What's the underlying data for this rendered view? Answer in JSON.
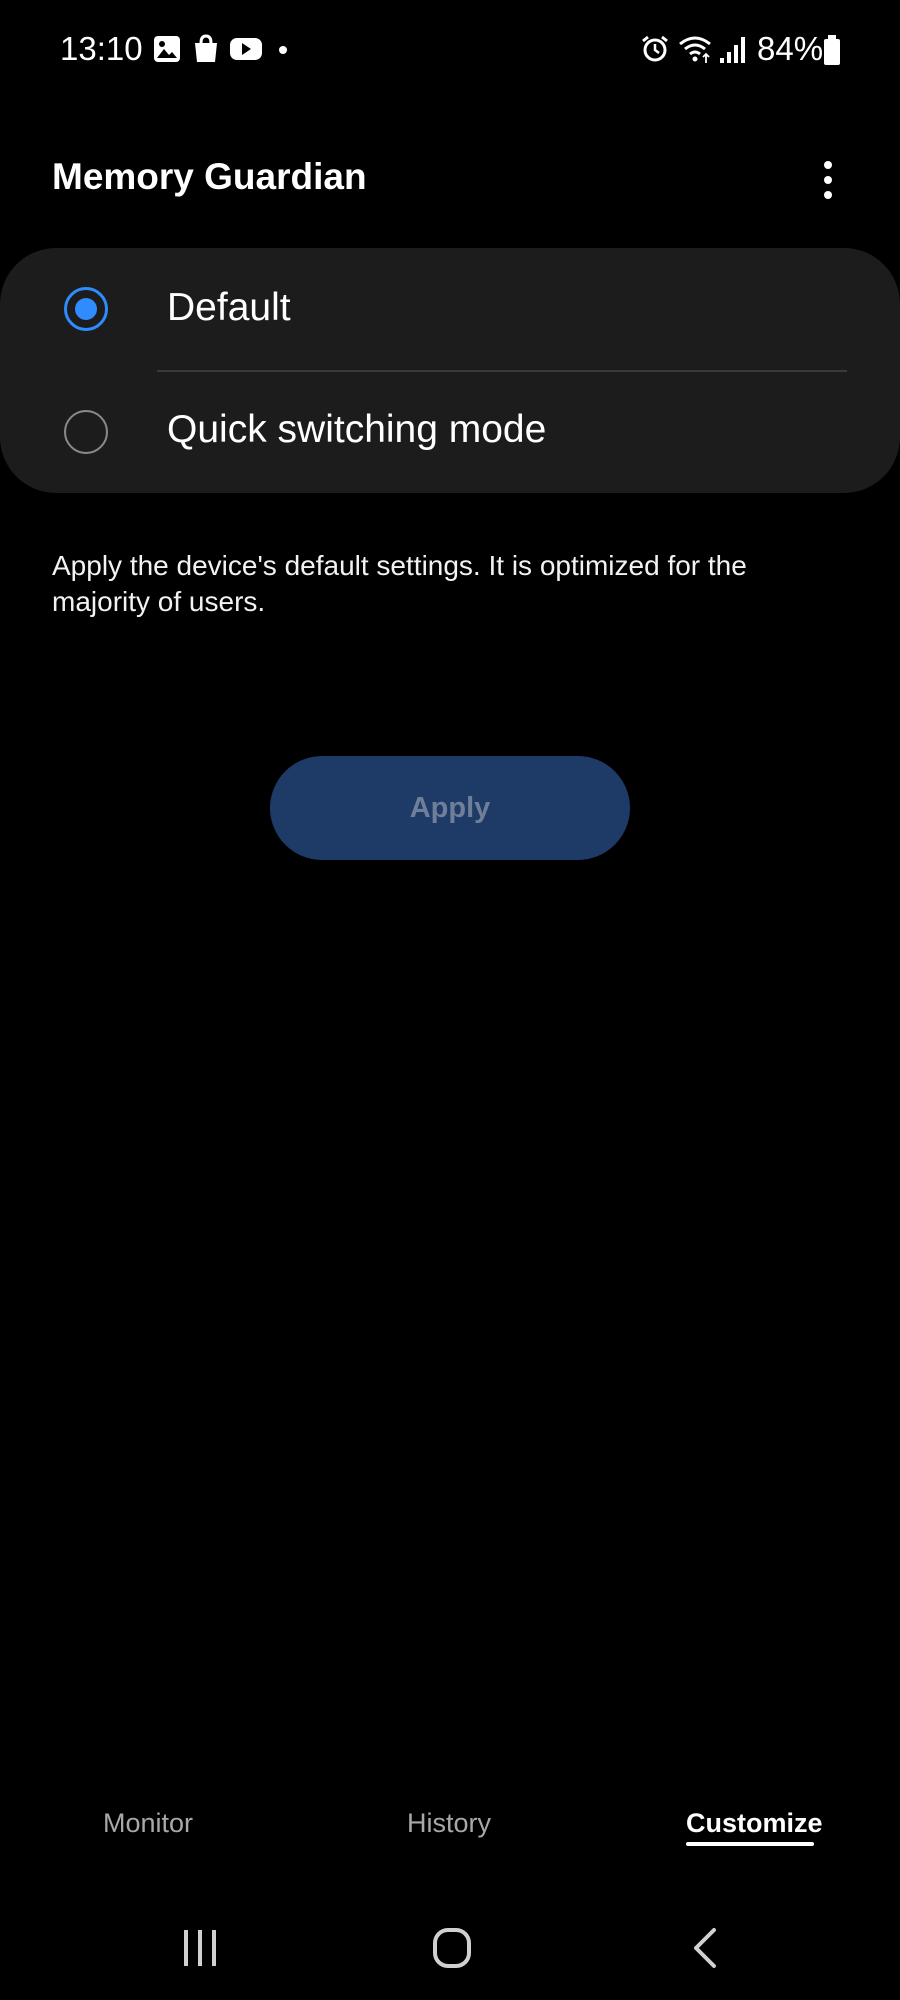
{
  "status_bar": {
    "time": "13:10",
    "notification_icons": [
      "gallery-icon",
      "shopping-bag-icon",
      "youtube-icon",
      "dot-icon"
    ],
    "system_icons": [
      "alarm-icon",
      "wifi-icon",
      "signal-icon",
      "battery-icon"
    ],
    "battery": "84%"
  },
  "header": {
    "title": "Memory Guardian",
    "more_icon": "more-vertical-icon"
  },
  "options": [
    {
      "label": "Default",
      "selected": true
    },
    {
      "label": "Quick switching mode",
      "selected": false
    }
  ],
  "description": "Apply the device's default settings. It is optimized for the majority of users.",
  "apply_button": {
    "label": "Apply",
    "enabled": false
  },
  "tabs": [
    {
      "label": "Monitor",
      "active": false
    },
    {
      "label": "History",
      "active": false
    },
    {
      "label": "Customize",
      "active": true
    }
  ],
  "nav_bar": [
    "recents-icon",
    "home-icon",
    "back-icon"
  ],
  "colors": {
    "accent": "#2f8cff",
    "card_background": "#1c1c1c",
    "apply_button_background": "#1e3a66"
  }
}
